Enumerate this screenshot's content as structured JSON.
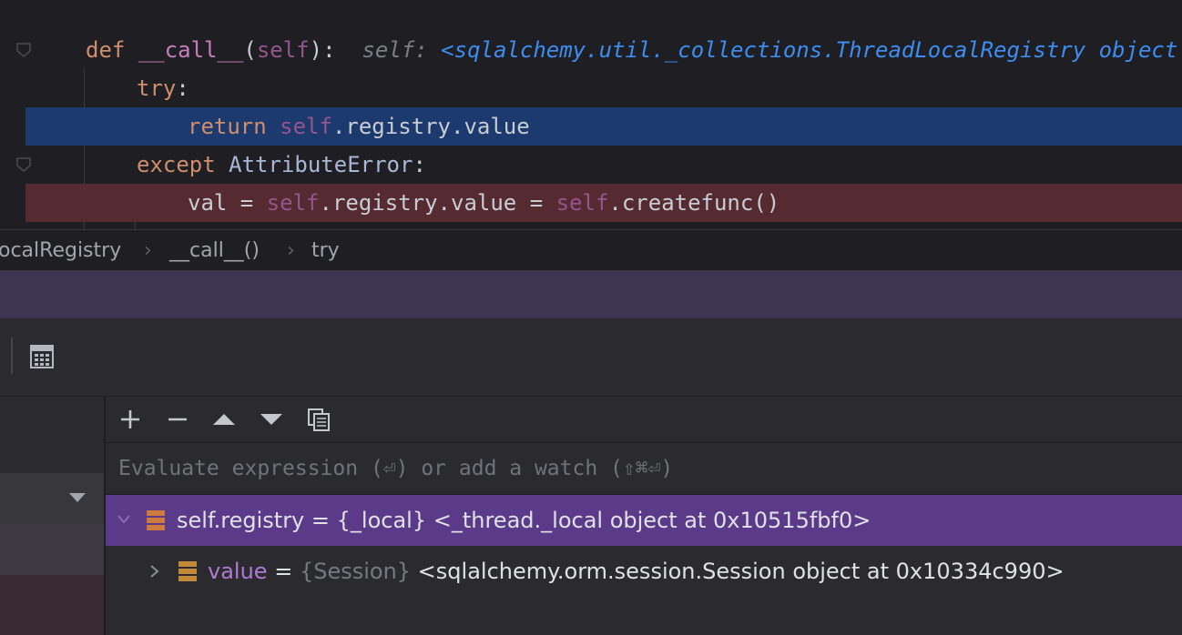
{
  "editor": {
    "lines": {
      "def_line": {
        "kw": "def",
        "name": "__call__",
        "open": "(",
        "self": "self",
        "close": "):",
        "hint_label": "self:",
        "hint_value": "<sqlalchemy.util._collections.ThreadLocalRegistry object at"
      },
      "try_line": {
        "kw": "try",
        "colon": ":"
      },
      "return_line": {
        "kw": "return",
        "self": "self",
        "rest": ".registry.value"
      },
      "except_line": {
        "kw": "except",
        "cls": "AttributeError",
        "colon": ":"
      },
      "assign_line": {
        "pre": "val = ",
        "self1": "self",
        "mid": ".registry.value = ",
        "self2": "self",
        "rest": ".createfunc()"
      }
    }
  },
  "breadcrumb": {
    "items": [
      "ocalRegistry",
      "__call__()",
      "try"
    ],
    "separator": "›"
  },
  "debugger": {
    "watch_toolbar": {
      "add_icon": "plus-icon",
      "remove_icon": "minus-icon",
      "up_icon": "arrow-up-icon",
      "down_icon": "arrow-down-icon",
      "copy_icon": "copy-icon"
    },
    "eval_placeholder": "Evaluate expression (⏎) or add a watch (⇧⌘⏎)",
    "watches": [
      {
        "name": "self.registry",
        "eq": " = ",
        "type": "{_local}",
        "value": " <_thread._local object at 0x10515fbf0>",
        "expanded": true
      },
      {
        "name": "value",
        "eq": " = ",
        "type": "{Session}",
        "value": " <sqlalchemy.orm.session.Session object at 0x10334c990>",
        "expanded": false
      }
    ]
  },
  "colors": {
    "current_line": "#1c3a6e",
    "breakpoint_line": "#552b31",
    "selected_watch": "#5c3a8a",
    "status_strip": "#3d3552"
  }
}
